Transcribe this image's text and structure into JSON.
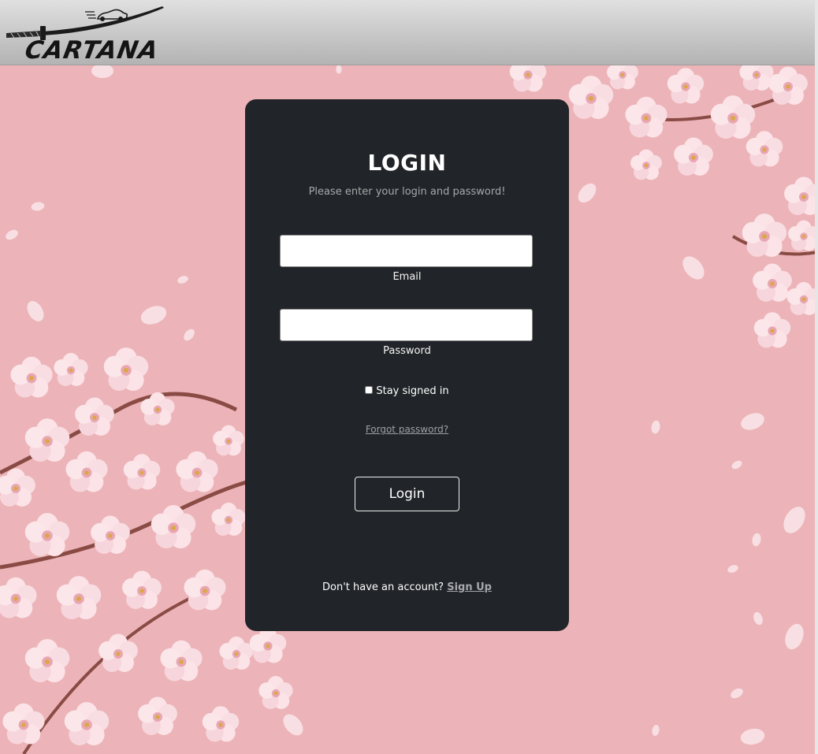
{
  "header": {
    "logo_text": "CARTANA"
  },
  "login": {
    "title": "LOGIN",
    "subtitle": "Please enter your login and password!",
    "email": {
      "label": "Email",
      "value": "",
      "placeholder": ""
    },
    "password": {
      "label": "Password",
      "value": "",
      "placeholder": ""
    },
    "remember_label": "Stay signed in",
    "remember_checked": false,
    "forgot_link": "Forgot password?",
    "login_button": "Login",
    "signup_prompt": "Don't have an account?",
    "signup_link": "Sign Up"
  },
  "colors": {
    "background": "#ecb4b8",
    "card": "#212428",
    "header_top": "#e0e0e0",
    "header_bottom": "#b3b3b3",
    "muted_text": "#a7a9ab"
  }
}
